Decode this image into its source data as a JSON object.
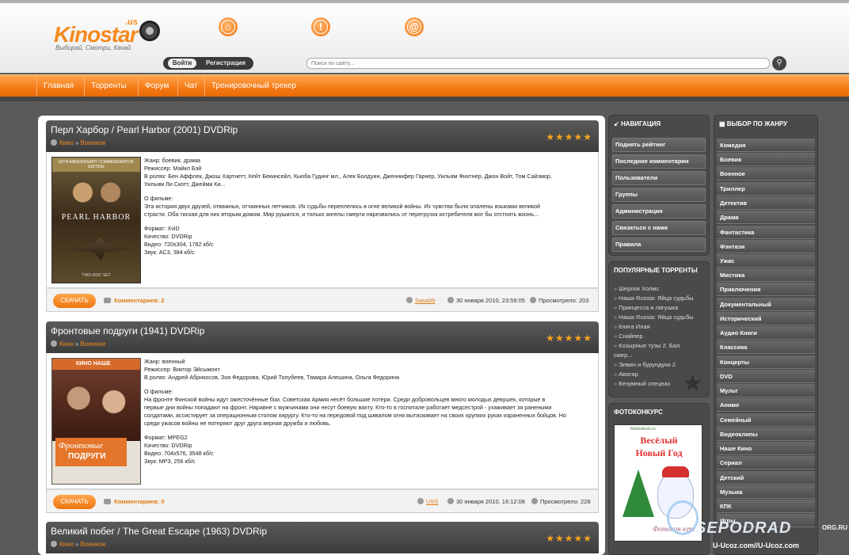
{
  "site": {
    "logo_text": "Kinostar",
    "logo_domain": ".us",
    "tagline": "Выбирай, Смотри, Качай"
  },
  "header": {
    "icons": [
      "home-icon",
      "info-icon",
      "email-icon"
    ],
    "login_label": "Войти",
    "register_label": "Регистрация",
    "search_placeholder": "Поиск по сайту..."
  },
  "nav": {
    "items": [
      "Главная",
      "Торренты",
      "Форум",
      "Чат",
      "Тренировочный трекер"
    ]
  },
  "posts": [
    {
      "title": "Перл Харбор / Pearl Harbor (2001) DVDRip",
      "crumb1": "Кино",
      "crumb2": "Военное",
      "rating": 5,
      "info_lines": [
        "Жанр: боевик, драма",
        "Режиссер: Майкл Бэй",
        "В ролях: Бен Аффлек, Джош Хартнетт, Кейт Бекинсейл, Кьюба Гудинг мл., Алек Болдуин, Дженнифер Гарнер, Уильям Фихтнер, Джон Войт, Том Сайзмор,",
        "Уильям Ли Скотт, Джейми Ки...",
        "",
        "О фильме:",
        "Эта история двух друзей, отважных, отчаянных летчиков. Их судьбы переплелись в огне великой войны. Их чувства были опалены языками великой",
        "страсти. Оба тиская для них вторым домом. Мир рушился, и только ангелы смерти нарезвились от перегрузок истребителя мог бы отстоять жизнь...",
        "",
        "Формат: XviD",
        "Качество: DVDRip",
        "Видео: 720x304, 1782 кб/с",
        "Звук: AC3, 384 кб/с"
      ],
      "poster_header": "60TH ANNIVERSARY COMMEMORATIVE EDITION",
      "poster_title": "PEARL HARBOR",
      "poster_footer": "TWO-DISC SET",
      "download_label": "СКАЧАТЬ",
      "comments_label": "Комментариев: 2",
      "author": "Sasa09",
      "date": "30 января 2010, 23:59:05",
      "views": "Просмотрело: 203"
    },
    {
      "title": "Фронтовые подруги (1941) DVDRip",
      "crumb1": "Кино",
      "crumb2": "Военное",
      "rating": 5,
      "info_lines": [
        "Жанр: военный",
        "Режиссер: Виктор Эйсымонт",
        "В ролях: Андрей Абрикосов, Зоя Федорова, Юрий Толубеев, Тамара Алешина, Ольга Федорина",
        "",
        "О фильме:",
        "На фронте Финской войны идут ожесточённые бои. Советская Армия несёт большие потери. Среди добровольцев много молодых девушек, которые в",
        "первые дни войны попадают на фронт. Наравне с мужчинами они несут боевую вахту. Кто-то в госпитале работает медсестрой - ухаживает за ранеными",
        "солдатами, ассистирует за операционным столом хирургу. Кто-то на передовой под шквалом огня вытаскивает на своих хрупких руках израненных бойцов. Но",
        "среди ужасов войны не потеряют друг друга верная дружба и любовь.",
        "",
        "Формат: MPEG2",
        "Качество: DVDRip",
        "Видео: 704x576, 3548 кб/с",
        "Звук: MP3, 256 кб/с"
      ],
      "poster_band": "КИНО НАШЕ",
      "poster_title1": "Фронтовые",
      "poster_title2": "ПОДРУГИ",
      "download_label": "СКАЧАТЬ",
      "comments_label": "Комментариев: 0",
      "author": "USS",
      "date": "30 января 2010, 16:12:08",
      "views": "Просмотрело: 228"
    },
    {
      "title": "Великий побег / The Great Escape (1963) DVDRip",
      "crumb1": "Кино",
      "crumb2": "Военное",
      "rating": 5
    }
  ],
  "sidebar_nav": {
    "title": "НАВИГАЦИЯ",
    "items": [
      "Поднять рейтинг",
      "Последние комментарии",
      "Пользователи",
      "Группы",
      "Администрация",
      "Связаться с нами",
      "Правила"
    ]
  },
  "popular": {
    "title": "ПОПУЛЯРНЫЕ ТОРРЕНТЫ",
    "items": [
      "Шерлок Холмс",
      "Наша Russia: Яйца судьбы",
      "Принцесса и лягушка",
      "Наша Russia: Яйца судьбы",
      "Книга Илая",
      "Снайпер",
      "Козырные тузы 2. Бал",
      "смер...",
      "Элвин и бурундуки 2",
      "Аватар",
      "Безумный спецназ"
    ]
  },
  "photocontest": {
    "title": "ФОТОКОНКУРС",
    "image_top": "fotokonkurs.ru",
    "line1": "Весёлый",
    "line2": "Новый Год",
    "sign": "Фотокон курс"
  },
  "genres": {
    "title": "ВЫБОР ПО ЖАНРУ",
    "items": [
      "Комедия",
      "Боевик",
      "Военное",
      "Триллер",
      "Детектив",
      "Драма",
      "Фантастика",
      "Фэнтази",
      "Ужас",
      "Мистика",
      "Приключения",
      "Документальный",
      "Исторический",
      "Аудио Книги",
      "Классика",
      "Концерты",
      "DVD",
      "Мульт",
      "Аниме",
      "Семейный",
      "Видеоклипы",
      "Наше Кино",
      "Сериал",
      "Детский",
      "Музыка",
      "КПК",
      "Игры"
    ]
  },
  "watermark": {
    "brand": "SEPODRAD",
    "suffix": "ORG.RU",
    "url": "U-Ucoz.com//U-Ucoz.com"
  }
}
